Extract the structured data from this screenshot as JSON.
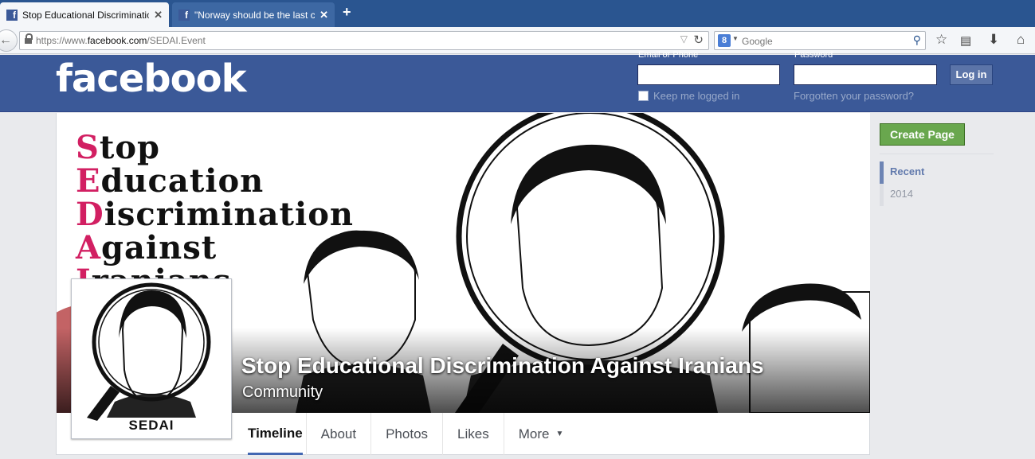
{
  "browser": {
    "tabs": [
      {
        "title": "Stop Educational Discriminatio...",
        "active": true
      },
      {
        "title": "\"Norway should be the last ch...",
        "active": false
      }
    ],
    "new_tab_label": "+",
    "url_prefix": "https://www.",
    "url_host": "facebook.com",
    "url_path": "/SEDAI.Event",
    "search_engine_icon": "8",
    "search_placeholder": "Google"
  },
  "header": {
    "logo": "facebook",
    "email_label": "Email or Phone",
    "password_label": "Password",
    "keep_logged_in": "Keep me logged in",
    "forgot_password": "Forgotten your password?",
    "login_button": "Log in"
  },
  "page": {
    "cover_lines": [
      {
        "cap": "S",
        "rest": "top"
      },
      {
        "cap": "E",
        "rest": "ducation"
      },
      {
        "cap": "D",
        "rest": "iscrimination"
      },
      {
        "cap": "A",
        "rest": "gainst"
      },
      {
        "cap": "I",
        "rest": "ranians"
      }
    ],
    "name": "Stop Educational Discrimination Against Iranians",
    "category": "Community",
    "profile_label": "SEDAI",
    "tabs": [
      "Timeline",
      "About",
      "Photos",
      "Likes",
      "More"
    ]
  },
  "sidebar": {
    "create_page": "Create Page",
    "recent_label": "Recent",
    "years": [
      "2014"
    ]
  },
  "colors": {
    "fb_blue": "#3b5998",
    "accent_pink": "#d21f62",
    "create_green": "#69a74e"
  }
}
